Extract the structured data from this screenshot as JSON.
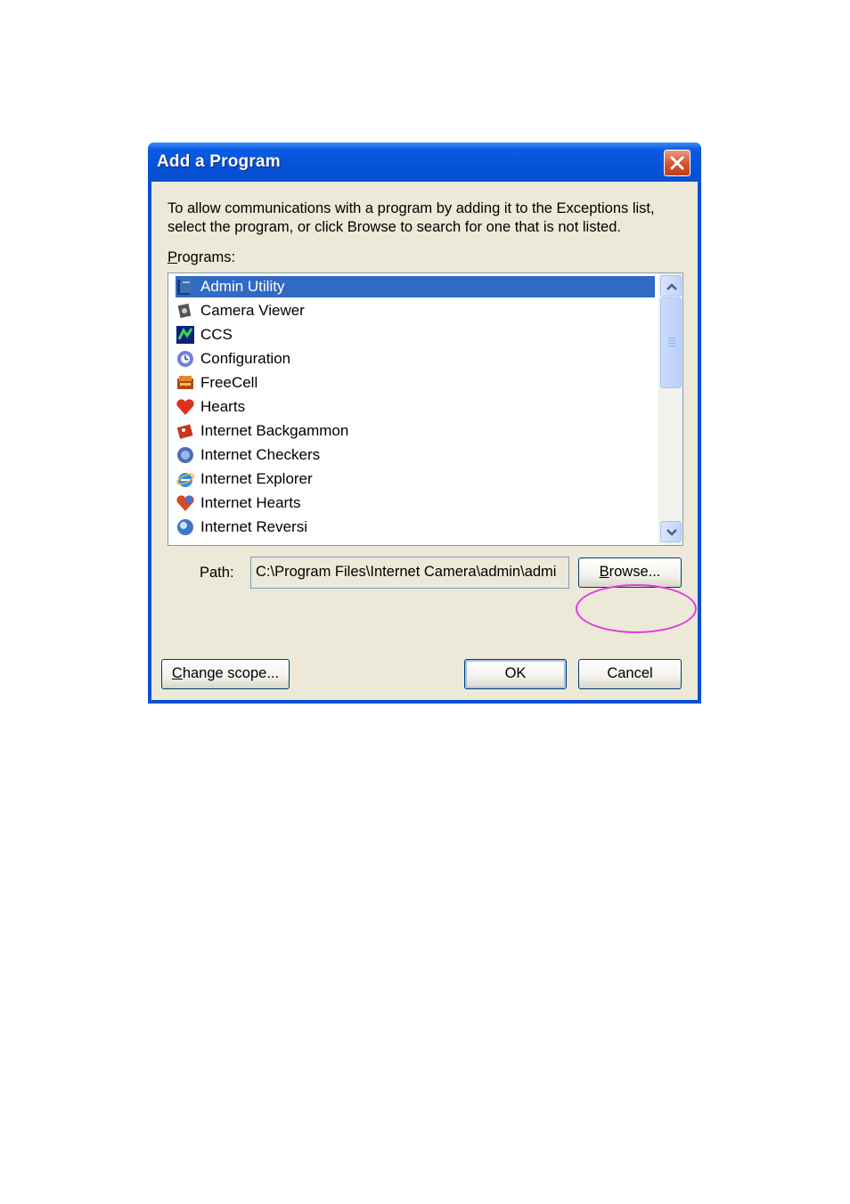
{
  "dialog": {
    "title": "Add a Program",
    "description": "To allow communications with a program by adding it to the Exceptions list, select the program, or click Browse to search for one that is not listed.",
    "programs_label": "Programs:",
    "programs_label_rest": "rograms:",
    "path_label": "Path:",
    "path_value": "C:\\Program Files\\Internet Camera\\admin\\admi",
    "browse_button_rest": "rowse...",
    "browse_button": "Browse...",
    "change_scope_rest": "hange scope...",
    "change_scope_button": "Change scope...",
    "ok_button": "OK",
    "cancel_button": "Cancel"
  },
  "programs": [
    {
      "label": "Admin Utility",
      "icon": "admin-utility-icon",
      "selected": true
    },
    {
      "label": "Camera Viewer",
      "icon": "camera-viewer-icon"
    },
    {
      "label": "CCS",
      "icon": "ccs-icon"
    },
    {
      "label": "Configuration",
      "icon": "configuration-icon"
    },
    {
      "label": "FreeCell",
      "icon": "freecell-icon"
    },
    {
      "label": "Hearts",
      "icon": "hearts-icon"
    },
    {
      "label": "Internet Backgammon",
      "icon": "internet-backgammon-icon"
    },
    {
      "label": "Internet Checkers",
      "icon": "internet-checkers-icon"
    },
    {
      "label": "Internet Explorer",
      "icon": "internet-explorer-icon"
    },
    {
      "label": "Internet Hearts",
      "icon": "internet-hearts-icon"
    },
    {
      "label": "Internet Reversi",
      "icon": "internet-reversi-icon"
    }
  ],
  "colors": {
    "selection": "#316ac5",
    "highlight_circle": "#e23ce0",
    "titlebar": "#0452d9"
  }
}
